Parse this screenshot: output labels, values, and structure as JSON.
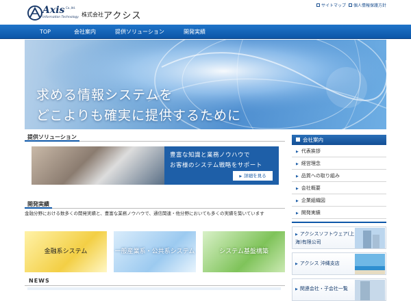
{
  "header": {
    "logo_text": "Axis",
    "logo_sub1": "Co.,ltd.",
    "logo_sub2": "Information Technology",
    "company_prefix": "株式会社",
    "company_name": "アクシス",
    "top_links": [
      "サイトマップ",
      "個人情報保護方針"
    ]
  },
  "nav": {
    "items": [
      "TOP",
      "会社案内",
      "提供ソリューション",
      "開発実績"
    ]
  },
  "hero": {
    "line1": "求める情報システムを",
    "line2": "どこよりも確実に提供するために"
  },
  "solution": {
    "heading": "提供ソリューション",
    "banner_line1": "豊富な知識と業務ノウハウで",
    "banner_line2": "お客様のシステム戦略をサポート",
    "button_label": "詳細を見る"
  },
  "development": {
    "heading": "開発実績",
    "description": "金融分野における数多くの開発実績と、豊富な業務ノウハウで、通信関連・他分野においても多くの実績を築いています",
    "categories": [
      "金融系システム",
      "一般産業系・公共系システム",
      "システム基盤構築"
    ]
  },
  "news": {
    "heading": "NEWS"
  },
  "sidebar": {
    "heading": "会社案内",
    "items": [
      "代表挨拶",
      "経営理念",
      "品質への取り組み",
      "会社概要",
      "企業組織図",
      "開発実績"
    ],
    "promos": [
      "アクシスソフトウェア(上海)有限公司",
      "アクシス 沖縄支店",
      "関連会社・子会社一覧"
    ]
  },
  "colors": {
    "nav_blue": "#0c56a8",
    "accent_blue": "#1e5fa8"
  }
}
